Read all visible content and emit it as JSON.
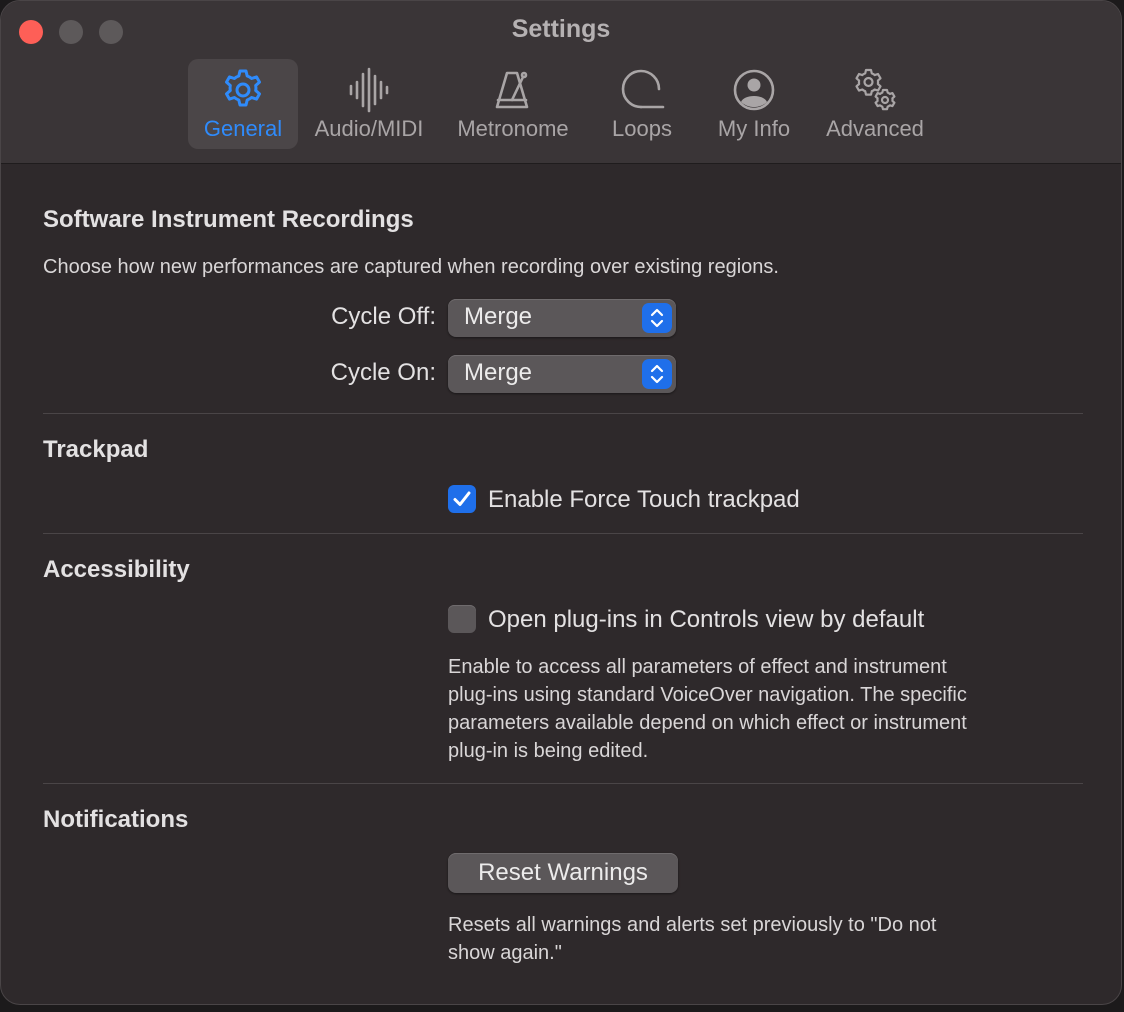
{
  "window": {
    "title": "Settings"
  },
  "tabs": [
    {
      "label": "General",
      "icon": "gear-icon",
      "selected": true
    },
    {
      "label": "Audio/MIDI",
      "icon": "waveform-icon",
      "selected": false
    },
    {
      "label": "Metronome",
      "icon": "metronome-icon",
      "selected": false
    },
    {
      "label": "Loops",
      "icon": "loop-icon",
      "selected": false
    },
    {
      "label": "My Info",
      "icon": "person-icon",
      "selected": false
    },
    {
      "label": "Advanced",
      "icon": "gears-icon",
      "selected": false
    }
  ],
  "software_instrument": {
    "heading": "Software Instrument Recordings",
    "description": "Choose how new performances are captured when recording over existing regions.",
    "cycle_off_label": "Cycle Off:",
    "cycle_off_value": "Merge",
    "cycle_on_label": "Cycle On:",
    "cycle_on_value": "Merge"
  },
  "trackpad": {
    "heading": "Trackpad",
    "force_touch_label": "Enable Force Touch trackpad",
    "force_touch_checked": true
  },
  "accessibility": {
    "heading": "Accessibility",
    "controls_view_label": "Open plug-ins in Controls view by default",
    "controls_view_checked": false,
    "help_line1": "Enable to access all parameters of effect and instrument",
    "help_line2": "plug-ins using standard VoiceOver navigation. The specific",
    "help_line3": "parameters available depend on which effect or instrument",
    "help_line4": "plug-in is being edited."
  },
  "notifications": {
    "heading": "Notifications",
    "reset_button_label": "Reset Warnings",
    "help_line1": "Resets all warnings and alerts set previously to \"Do not",
    "help_line2": "show again.\""
  },
  "colors": {
    "accent": "#2f8bfb",
    "window_bg": "#2e292b",
    "titlebar_bg": "#3a3537",
    "close_red": "#fe5f57"
  }
}
